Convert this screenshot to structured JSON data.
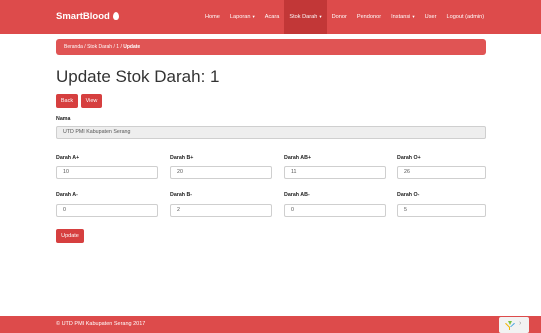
{
  "navbar": {
    "brand": "SmartBlood",
    "items": [
      {
        "label": "Home",
        "dropdown": false
      },
      {
        "label": "Laporan",
        "dropdown": true
      },
      {
        "label": "Acara",
        "dropdown": false
      },
      {
        "label": "Stok Darah",
        "dropdown": true,
        "active": true
      },
      {
        "label": "Donor",
        "dropdown": false
      },
      {
        "label": "Pendonor",
        "dropdown": false
      },
      {
        "label": "Instansi",
        "dropdown": true
      },
      {
        "label": "User",
        "dropdown": false
      },
      {
        "label": "Logout (admin)",
        "dropdown": false
      }
    ],
    "caret": "▾"
  },
  "breadcrumb": {
    "items": [
      "Beranda",
      "Stok Darah",
      "1"
    ],
    "current": "Update",
    "separator": "/"
  },
  "page": {
    "title": "Update Stok Darah: 1",
    "back_label": "Back",
    "view_label": "View",
    "update_label": "Update"
  },
  "form": {
    "nama_label": "Nama",
    "nama_value": "UTD PMI Kabupaten Serang",
    "fields": [
      {
        "label": "Darah A+",
        "value": "10"
      },
      {
        "label": "Darah B+",
        "value": "20"
      },
      {
        "label": "Darah AB+",
        "value": "11"
      },
      {
        "label": "Darah O+",
        "value": "26"
      },
      {
        "label": "Darah A-",
        "value": "0"
      },
      {
        "label": "Darah B-",
        "value": "2"
      },
      {
        "label": "Darah AB-",
        "value": "0"
      },
      {
        "label": "Darah O-",
        "value": "5"
      }
    ]
  },
  "footer": {
    "text": "© UTD PMI Kabupaten Serang 2017"
  },
  "colors": {
    "primary": "#dd4b4b",
    "active_nav": "#c23737",
    "button": "#d63f3f"
  }
}
